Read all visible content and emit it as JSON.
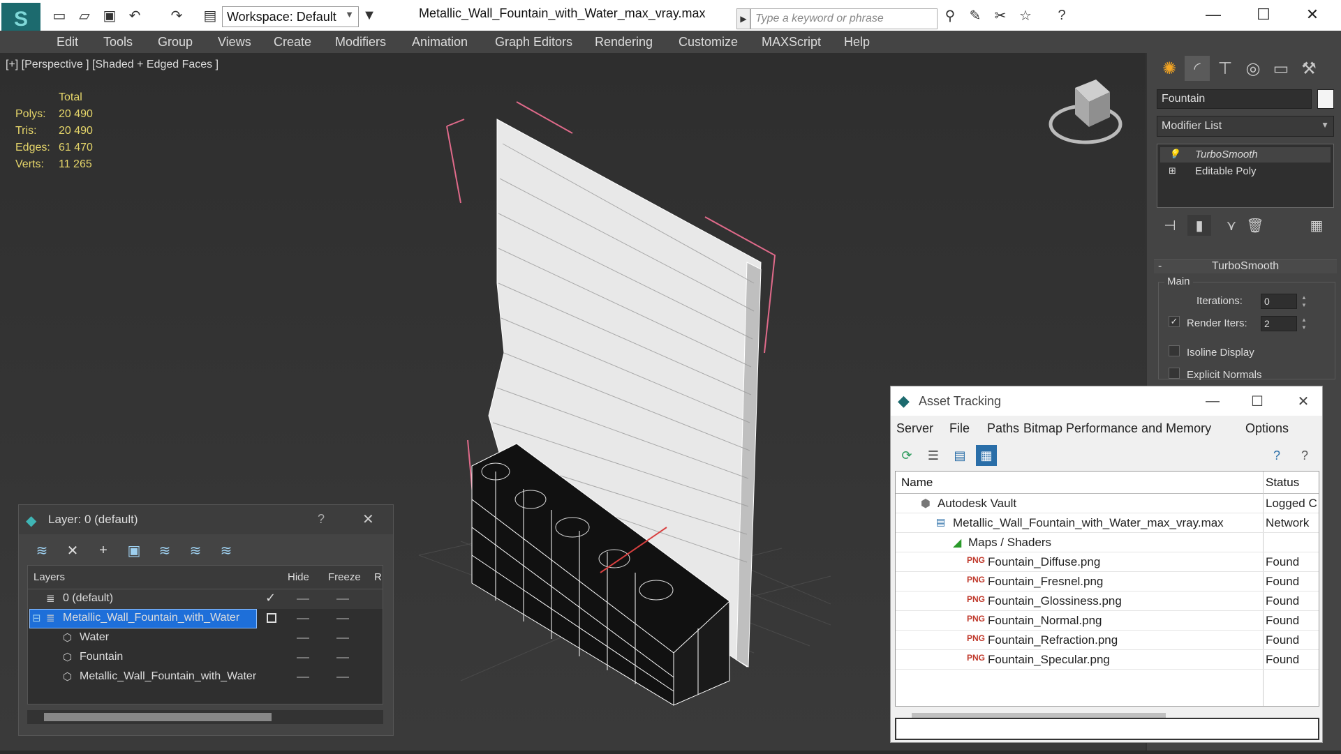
{
  "titlebar": {
    "workspace": "Workspace: Default",
    "file_title": "Metallic_Wall_Fountain_with_Water_max_vray.max",
    "search_placeholder": "Type a keyword or phrase"
  },
  "menu": [
    "Edit",
    "Tools",
    "Group",
    "Views",
    "Create",
    "Modifiers",
    "Animation",
    "Graph Editors",
    "Rendering",
    "Customize",
    "MAXScript",
    "Help"
  ],
  "viewport": {
    "label": "[+] [Perspective ] [Shaded + Edged Faces ]",
    "stats": {
      "header": "Total",
      "rows": [
        {
          "label": "Polys:",
          "value": "20 490"
        },
        {
          "label": "Tris:",
          "value": "20 490"
        },
        {
          "label": "Edges:",
          "value": "61 470"
        },
        {
          "label": "Verts:",
          "value": "11 265"
        }
      ]
    }
  },
  "command_panel": {
    "object_name": "Fountain",
    "modifier_list": "Modifier List",
    "stack": [
      "TurboSmooth",
      "Editable Poly"
    ],
    "rollout_title": "TurboSmooth",
    "group_label": "Main",
    "iterations_label": "Iterations:",
    "iterations_value": "0",
    "render_iters_label": "Render Iters:",
    "render_iters_value": "2",
    "isoline_label": "Isoline Display",
    "explicit_normals_label": "Explicit Normals"
  },
  "layer_window": {
    "title": "Layer: 0 (default)",
    "help": "?",
    "columns": {
      "layers": "Layers",
      "hide": "Hide",
      "freeze": "Freeze",
      "render": "R"
    },
    "rows": [
      {
        "name": "0 (default)"
      },
      {
        "name": "Metallic_Wall_Fountain_with_Water"
      },
      {
        "name": "Water"
      },
      {
        "name": "Fountain"
      },
      {
        "name": "Metallic_Wall_Fountain_with_Water"
      }
    ]
  },
  "asset_window": {
    "title": "Asset Tracking",
    "menu": [
      "Server",
      "File",
      "Paths",
      "Bitmap Performance and Memory",
      "Options"
    ],
    "columns": {
      "name": "Name",
      "status": "Status"
    },
    "rows": [
      {
        "name": "Autodesk Vault",
        "status": "Logged C"
      },
      {
        "name": "Metallic_Wall_Fountain_with_Water_max_vray.max",
        "status": "Network"
      },
      {
        "name": "Maps / Shaders",
        "status": ""
      },
      {
        "name": "Fountain_Diffuse.png",
        "status": "Found"
      },
      {
        "name": "Fountain_Fresnel.png",
        "status": "Found"
      },
      {
        "name": "Fountain_Glossiness.png",
        "status": "Found"
      },
      {
        "name": "Fountain_Normal.png",
        "status": "Found"
      },
      {
        "name": "Fountain_Refraction.png",
        "status": "Found"
      },
      {
        "name": "Fountain_Specular.png",
        "status": "Found"
      }
    ]
  },
  "colors": {
    "accent": "#1c6a6e",
    "stats_yellow": "#e6d66a",
    "selection": "#1e6fd9",
    "png_red": "#c0392b"
  }
}
